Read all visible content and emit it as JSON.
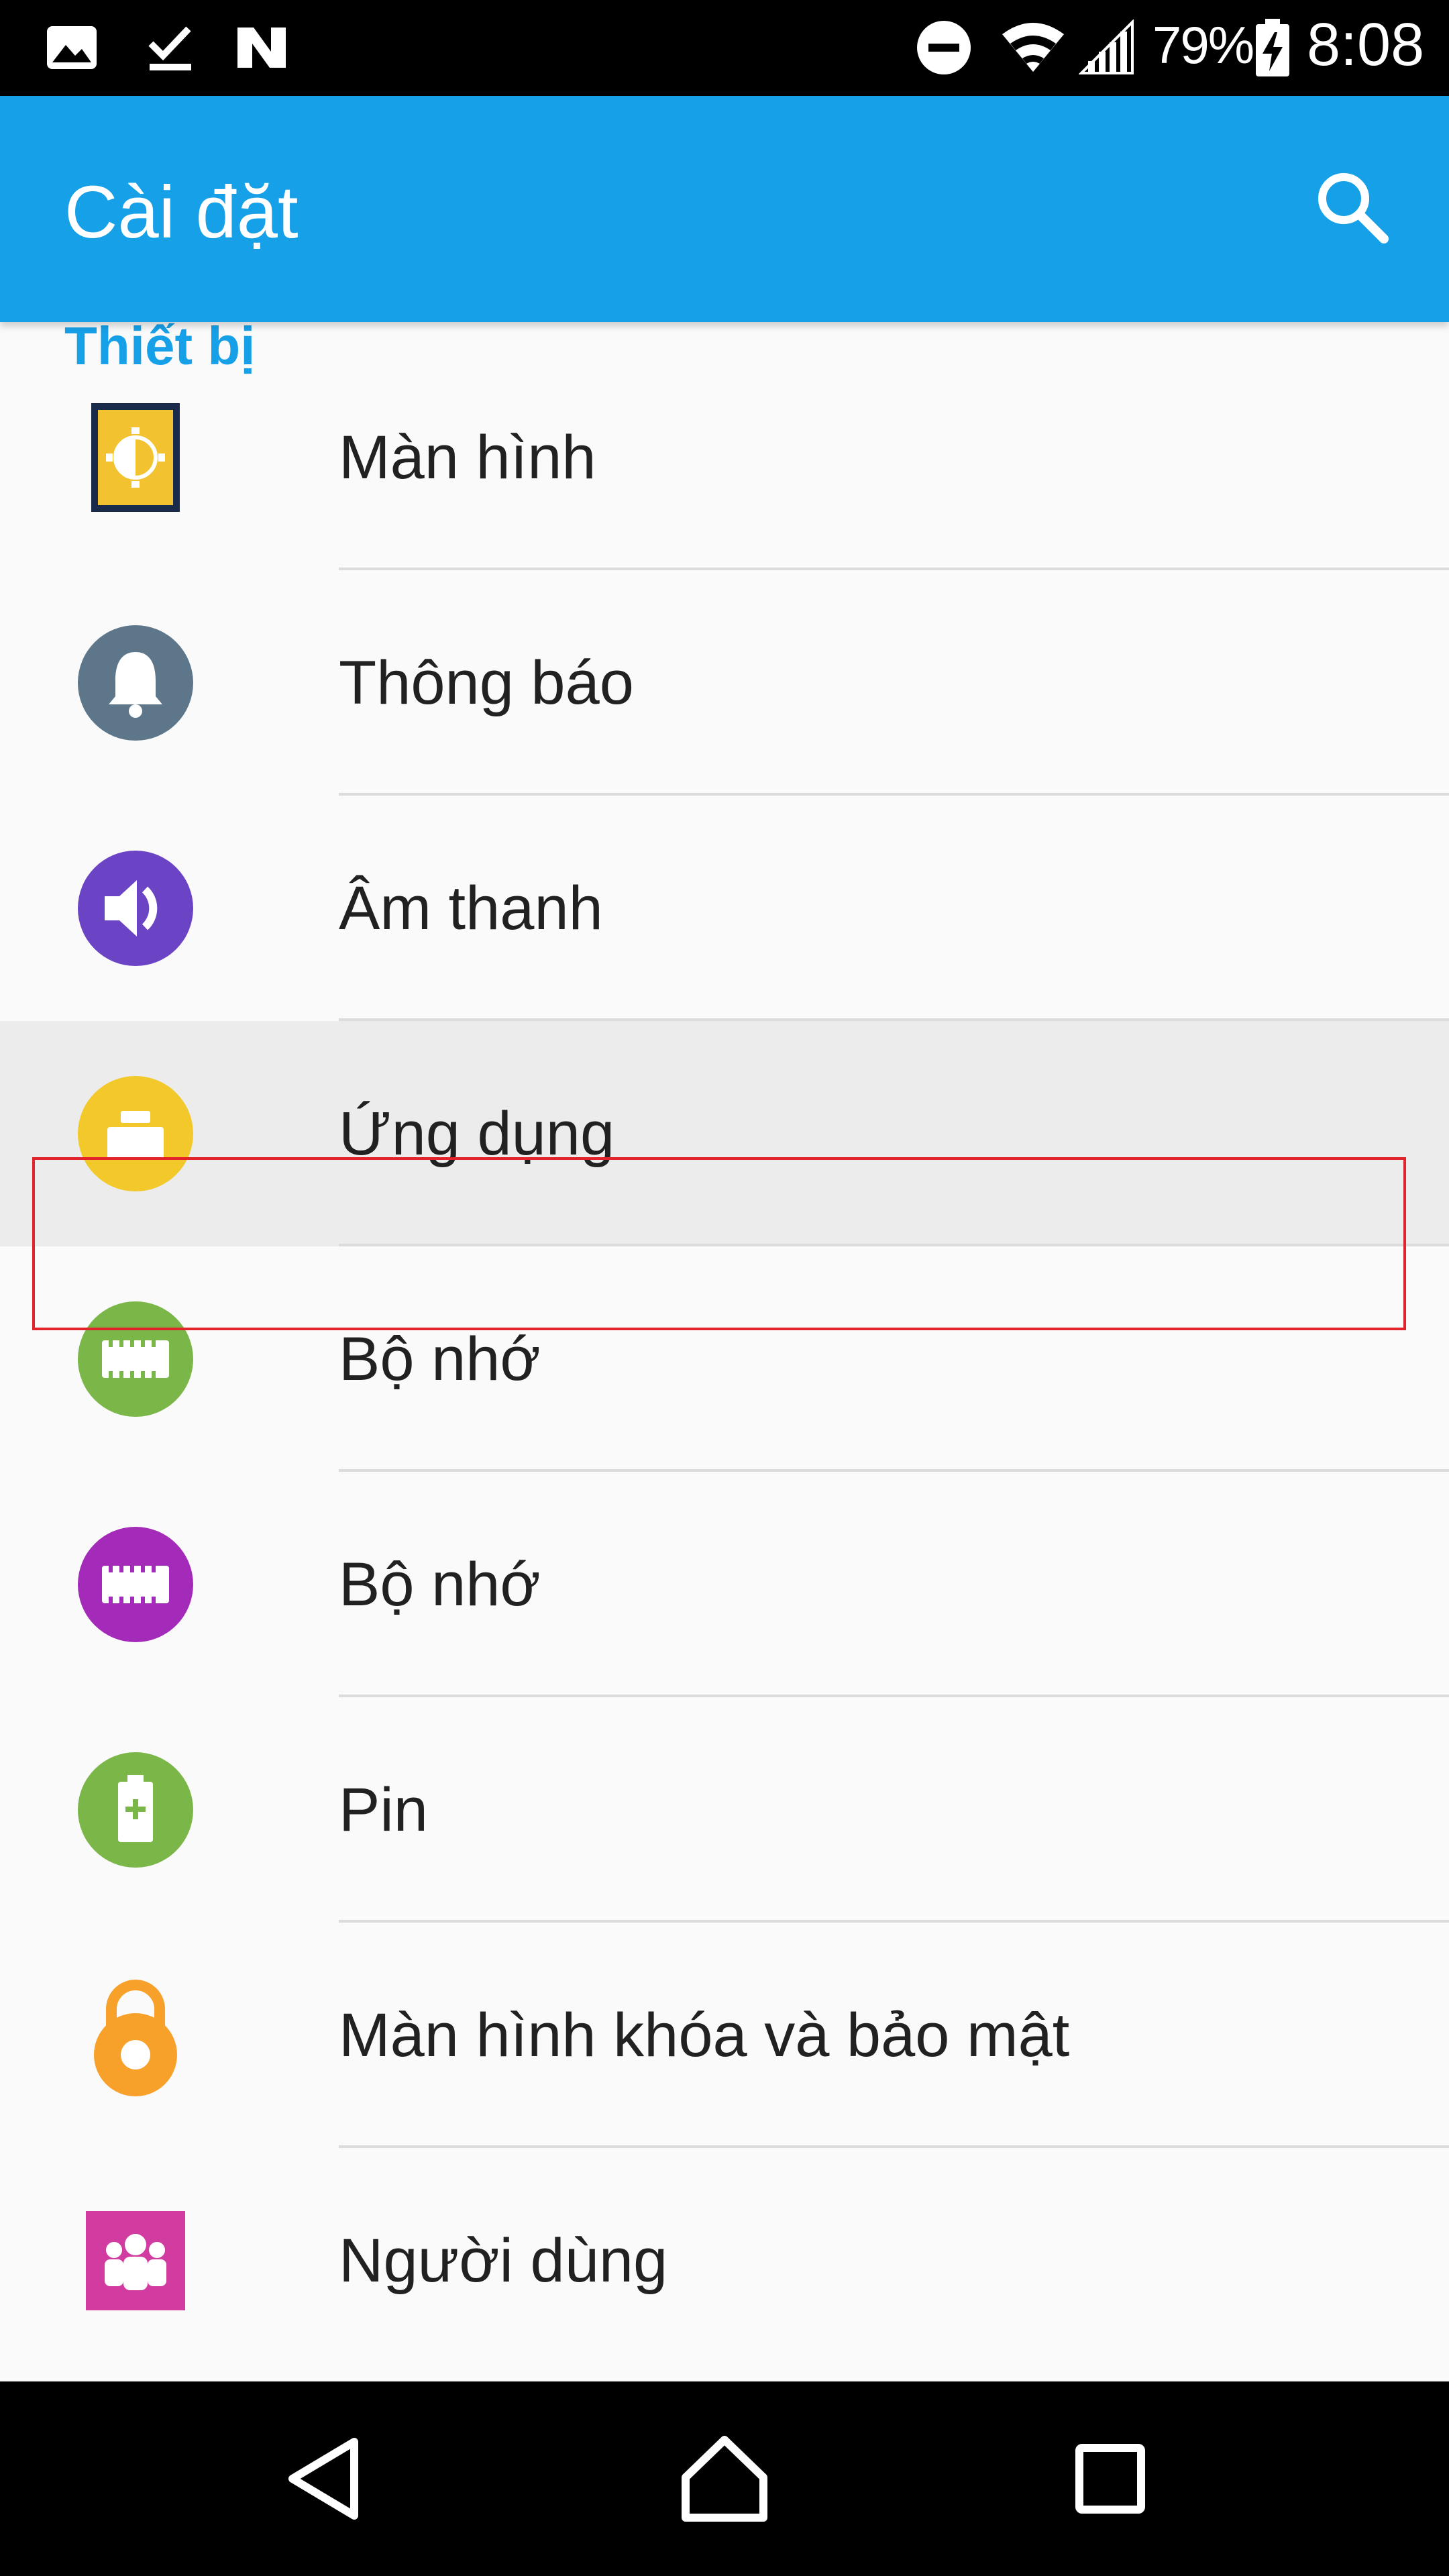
{
  "status_bar": {
    "battery_percent": "79%",
    "time": "8:08",
    "icons": [
      "image-icon",
      "download-done-icon",
      "nfc-icon",
      "do-not-disturb-icon",
      "wifi-icon",
      "signal-icon",
      "battery-charging-icon"
    ]
  },
  "app_bar": {
    "title": "Cài đặt",
    "search_icon": "search-icon"
  },
  "section": {
    "header": "Thiết bị"
  },
  "settings_items": [
    {
      "label": "Màn hình",
      "icon": "display-icon",
      "color": "#f2c230"
    },
    {
      "label": "Thông báo",
      "icon": "bell-icon",
      "color": "#5e7689"
    },
    {
      "label": "Âm thanh",
      "icon": "speaker-icon",
      "color": "#6a44c4"
    },
    {
      "label": "Ứng dụng",
      "icon": "apps-icon",
      "color": "#f2c82a",
      "highlighted": true
    },
    {
      "label": "Bộ nhớ",
      "icon": "storage-chip-icon",
      "color": "#7ab648"
    },
    {
      "label": "Bộ nhớ",
      "icon": "memory-chip-icon",
      "color": "#a42bb9"
    },
    {
      "label": "Pin",
      "icon": "battery-icon",
      "color": "#7ab648"
    },
    {
      "label": "Màn hình khóa và bảo mật",
      "icon": "lock-icon",
      "color": "#f7a12a"
    },
    {
      "label": "Người dùng",
      "icon": "users-icon",
      "color": "#d23ca0"
    }
  ],
  "nav_bar": {
    "back": "back-icon",
    "home": "home-icon",
    "recents": "recents-icon"
  }
}
